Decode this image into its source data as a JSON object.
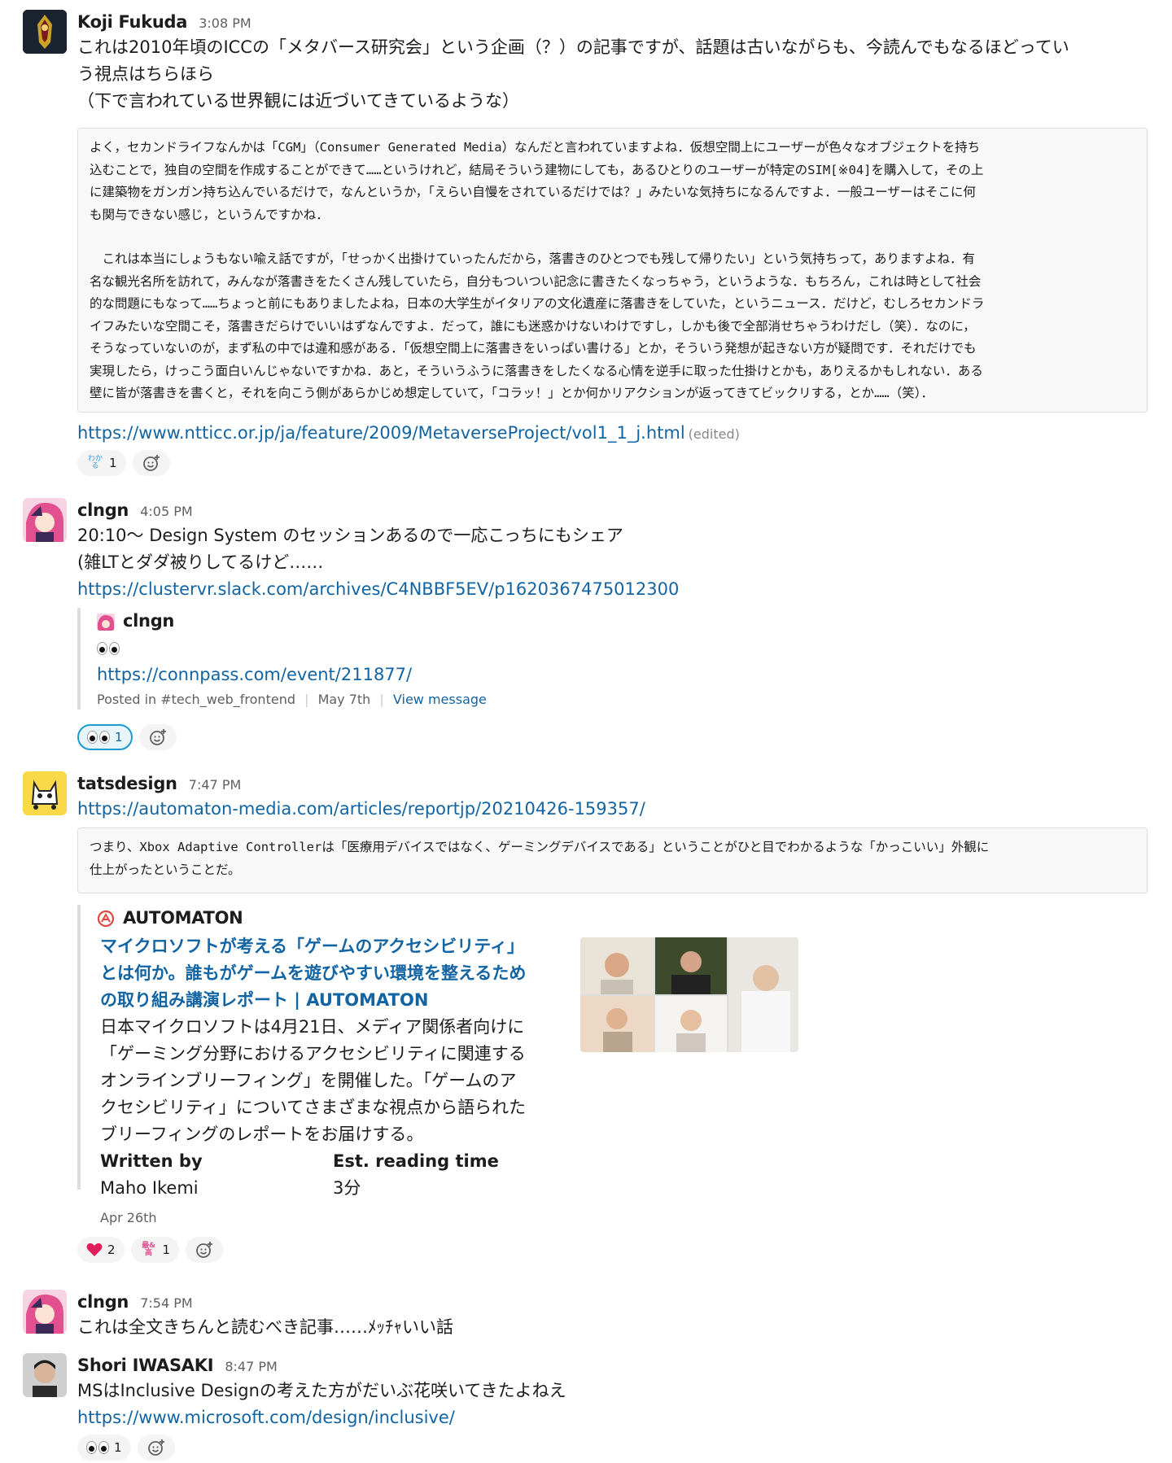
{
  "messages": {
    "m1": {
      "author": "Koji Fukuda",
      "time": "3:08 PM",
      "lines": [
        "これは2010年頃のICCの「メタバース研究会」という企画（？）の記事ですが、話題は古いながらも、今読んでもなるほどってい",
        "う視点はちらほら",
        "（下で言われている世界観には近づいてきているような）"
      ],
      "quote": [
        "よく，セカンドライフなんかは「CGM」（Consumer Generated Media）なんだと言われていますよね．仮想空間上にユーザーが色々なオブジェクトを持ち",
        "込むことで，独自の空間を作成することができて……というけれど，結局そういう建物にしても，あるひとりのユーザーが特定のSIM[※04]を購入して，その上",
        "に建築物をガンガン持ち込んでいるだけで，なんというか，「えらい自慢をされているだけでは？」みたいな気持ちになるんですよ．一般ユーザーはそこに何",
        "も関与できない感じ，というんですかね．",
        "",
        "　これは本当にしょうもない喩え話ですが，「せっかく出掛けていったんだから，落書きのひとつでも残して帰りたい」という気持ちって，ありますよね．有",
        "名な観光名所を訪れて，みんなが落書きをたくさん残していたら，自分もついつい記念に書きたくなっちゃう，というような．もちろん，これは時として社会",
        "的な問題にもなって……ちょっと前にもありましたよね，日本の大学生がイタリアの文化遺産に落書きをしていた，というニュース．だけど，むしろセカンドラ",
        "イフみたいな空間こそ，落書きだらけでいいはずなんですよ．だって，誰にも迷惑かけないわけですし，しかも後で全部消せちゃうわけだし（笑）．なのに，",
        "そうなっていないのが，まず私の中では違和感がある．「仮想空間上に落書きをいっぱい書ける」とか，そういう発想が起きない方が疑問です．それだけでも",
        "実現したら，けっこう面白いんじゃないですかね．あと，そういうふうに落書きをしたくなる心情を逆手に取った仕掛けとかも，ありえるかもしれない．ある",
        "壁に皆が落書きを書くと，それを向こう側があらかじめ想定していて，「コラッ！」とか何かリアクションが返ってきてビックリする，とか……（笑）．"
      ],
      "link": "https://www.ntticc.or.jp/ja/feature/2009/MetaverseProject/vol1_1_j.html",
      "edited": "(edited)",
      "reaction_count": "1",
      "reaction_glyph": "わか る"
    },
    "m2": {
      "author": "clngn",
      "time": "4:05 PM",
      "lines": [
        "20:10〜 Design System のセッションあるので一応こっちにもシェア",
        "(雑LTとダダ被りしてるけど……"
      ],
      "link": "https://clustervr.slack.com/archives/C4NBBF5EV/p1620367475012300",
      "share": {
        "author": "clngn",
        "link": "https://connpass.com/event/211877/",
        "posted_in": "Posted in #tech_web_frontend",
        "date": "May 7th",
        "view": "View message"
      },
      "reaction_count": "1"
    },
    "m3": {
      "author": "tatsdesign",
      "time": "7:47 PM",
      "link": "https://automaton-media.com/articles/reportjp/20210426-159357/",
      "quote": [
        "つまり、Xbox Adaptive Controllerは「医療用デバイスではなく、ゲーミングデバイスである」ということがひと目でわかるような「かっこいい」外観に",
        "仕上がったということだ。"
      ],
      "unfurl": {
        "site": "AUTOMATON",
        "title_lines": [
          "マイクロソフトが考える「ゲームのアクセシビリティ」",
          "とは何か。誰もがゲームを遊びやすい環境を整えるため",
          "の取り組み講演レポート | AUTOMATON"
        ],
        "desc_lines": [
          "日本マイクロソフトは4月21日、メディア関係者向けに",
          "「ゲーミング分野におけるアクセシビリティに関連する",
          "オンラインブリーフィング」を開催した。「ゲームのア",
          "クセシビリティ」についてさまざまな視点から語られた",
          "ブリーフィングのレポートをお届けする。"
        ],
        "written_by_label": "Written by",
        "written_by": "Maho Ikemi",
        "reading_label": "Est. reading time",
        "reading": "3分",
        "date": "Apr 26th"
      },
      "reaction1_count": "2",
      "reaction2_count": "1",
      "reaction2_glyph": "最& 高"
    },
    "m4": {
      "author": "clngn",
      "time": "7:54 PM",
      "lines": [
        "これは全文きちんと読むべき記事……ﾒｯﾁｬいい話"
      ]
    },
    "m5": {
      "author": "Shori IWASAKI",
      "time": "8:47 PM",
      "lines": [
        "MSはInclusive Designの考えた方がだいぶ花咲いてきたよねえ"
      ],
      "link": "https://www.microsoft.com/design/inclusive/",
      "reaction_count": "1"
    }
  },
  "colors": {
    "link": "#1264a3",
    "reaction_active_border": "#1d9bd1",
    "heart": "#e01e5a"
  }
}
